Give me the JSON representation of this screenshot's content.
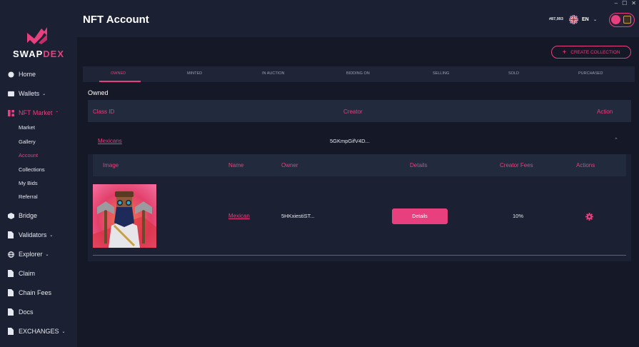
{
  "window": {
    "minimize": "–",
    "maximize": "☐",
    "close": "✕"
  },
  "brand": {
    "logo_part1": "SWAP",
    "logo_part2": "DEX",
    "accent": "#e8407e"
  },
  "sidebar": {
    "items": [
      {
        "label": "Home",
        "icon": "home-icon"
      },
      {
        "label": "Wallets",
        "icon": "wallet-icon",
        "chevron": "⌄"
      },
      {
        "label": "NFT Market",
        "icon": "grid-icon",
        "chevron": "⌃"
      },
      {
        "label": "Bridge",
        "icon": "cube-icon"
      },
      {
        "label": "Validators",
        "icon": "document-icon",
        "chevron": "⌄"
      },
      {
        "label": "Explorer",
        "icon": "globe-icon",
        "chevron": "⌄"
      },
      {
        "label": "Claim",
        "icon": "document-icon"
      },
      {
        "label": "Chain Fees",
        "icon": "document-icon"
      },
      {
        "label": "Docs",
        "icon": "document-icon"
      },
      {
        "label": "EXCHANGES",
        "icon": "document-icon",
        "chevron": "⌄"
      }
    ],
    "sub_items": [
      "Market",
      "Gallery",
      "Account",
      "Collections",
      "My Bids",
      "Referral"
    ]
  },
  "header": {
    "title": "NFT Account",
    "balance": "#87,993",
    "language": "EN",
    "chevron": "⌄"
  },
  "actions": {
    "create_collection": "CREATE COLLECTION",
    "plus": "+"
  },
  "tabs": [
    "OWNED",
    "MINTED",
    "IN AUCTION",
    "BIDDING ON",
    "SELLING",
    "SOLD",
    "PURCHASED"
  ],
  "section_label": "Owned",
  "outer_table": {
    "headers": {
      "class_id": "Class ID",
      "creator": "Creator",
      "action": "Action"
    },
    "row": {
      "class_id": "Mexicans",
      "creator": "5GKmpGifV4D...",
      "chevron": "⌃"
    }
  },
  "inner_table": {
    "headers": {
      "image": "Image",
      "name": "Name",
      "owner": "Owner",
      "details": "Details",
      "creator_fees": "Creator Fees",
      "actions": "Actions"
    },
    "row": {
      "name": "Mexican",
      "owner": "5HKxiestiST...",
      "details_button": "Details",
      "creator_fees": "10%"
    }
  }
}
